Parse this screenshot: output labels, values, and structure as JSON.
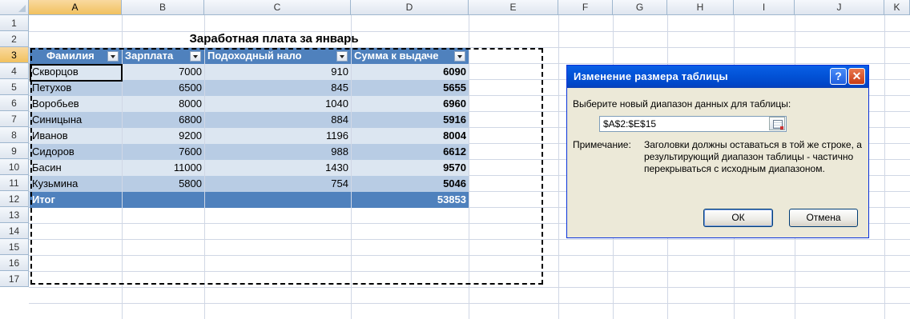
{
  "columns": [
    "A",
    "B",
    "C",
    "D",
    "E",
    "F",
    "G",
    "H",
    "I",
    "J",
    "K"
  ],
  "row_numbers": [
    "1",
    "2",
    "3",
    "4",
    "5",
    "6",
    "7",
    "8",
    "9",
    "10",
    "11",
    "12",
    "13",
    "14",
    "15",
    "16",
    "17"
  ],
  "title": "Заработная плата за январь",
  "headers": [
    "Фамилия",
    "Зарплата",
    "Подоходный нало",
    "Сумма к выдаче"
  ],
  "rows": [
    {
      "name": "Скворцов",
      "salary": "7000",
      "tax": "910",
      "payout": "6090"
    },
    {
      "name": "Петухов",
      "salary": "6500",
      "tax": "845",
      "payout": "5655"
    },
    {
      "name": "Воробьев",
      "salary": "8000",
      "tax": "1040",
      "payout": "6960"
    },
    {
      "name": "Синицына",
      "salary": "6800",
      "tax": "884",
      "payout": "5916"
    },
    {
      "name": "Иванов",
      "salary": "9200",
      "tax": "1196",
      "payout": "8004"
    },
    {
      "name": "Сидоров",
      "salary": "7600",
      "tax": "988",
      "payout": "6612"
    },
    {
      "name": "Басин",
      "salary": "11000",
      "tax": "1430",
      "payout": "9570"
    },
    {
      "name": "Кузьмина",
      "salary": "5800",
      "tax": "754",
      "payout": "5046"
    }
  ],
  "total": {
    "label": "Итог",
    "value": "53853"
  },
  "dialog": {
    "title": "Изменение размера таблицы",
    "help": "?",
    "close": "✕",
    "prompt": "Выберите новый диапазон данных для таблицы:",
    "range": "$A$2:$E$15",
    "note_label": "Примечание:",
    "note_text": "Заголовки должны оставаться в той же строке, а результирующий диапазон таблицы - частично перекрываться с исходным диапазоном.",
    "ok": "ОК",
    "cancel": "Отмена"
  },
  "colors": {
    "header_blue": "#4f81bd",
    "band_light": "#dce6f1",
    "band_dark": "#b8cce4",
    "dialog_bg": "#ece9d8"
  }
}
